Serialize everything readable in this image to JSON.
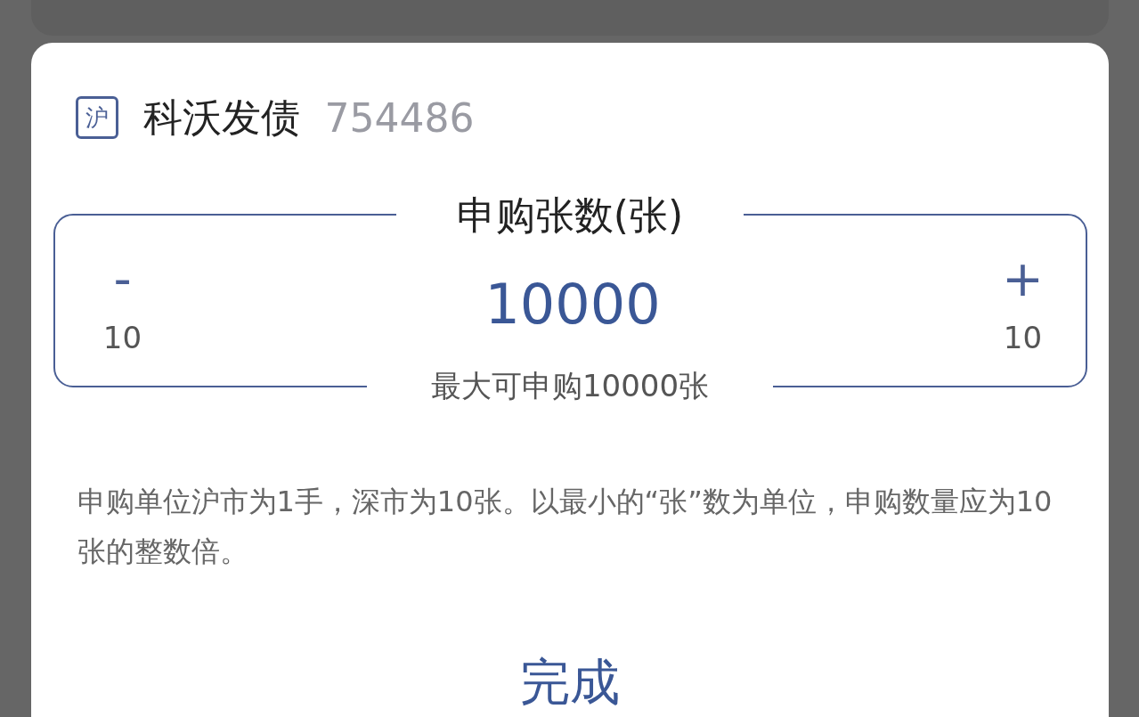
{
  "header": {
    "market_badge": "沪",
    "name": "科沃发债",
    "code": "754486"
  },
  "stepper": {
    "label": "申购张数(张)",
    "value": "10000",
    "max_note": "最大可申购10000张",
    "decrement": {
      "symbol": "-",
      "step": "10"
    },
    "increment": {
      "symbol": "+",
      "step": "10"
    }
  },
  "note": "申购单位沪市为1手，深市为10张。以最小的“张”数为单位，申购数量应为10张的整数倍。",
  "done_button": "完成"
}
